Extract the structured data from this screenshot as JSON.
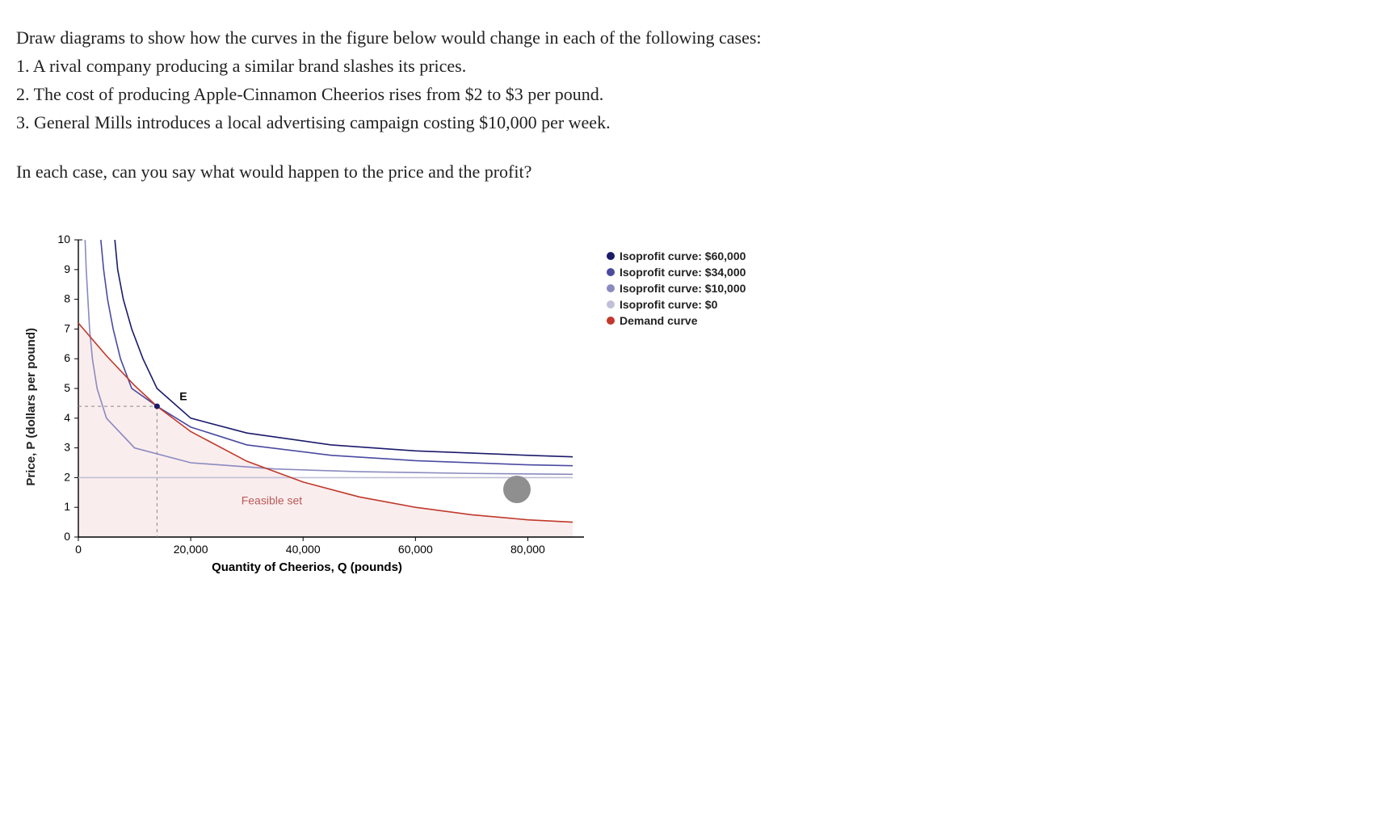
{
  "question": {
    "intro": "Draw diagrams to show how the curves in the figure below would change in each of the following cases:",
    "items": [
      "1. A rival company producing a similar brand slashes its prices.",
      "2. The cost of producing Apple-Cinnamon Cheerios rises from $2 to $3 per pound.",
      "3. General Mills introduces a local advertising campaign costing $10,000 per week."
    ],
    "followup": "In each case, can you say what would happen to the price and the profit?"
  },
  "chart_data": {
    "type": "line",
    "title": "",
    "xlabel": "Quantity of Cheerios, Q (pounds)",
    "ylabel": "Price, P (dollars per pound)",
    "xlim": [
      0,
      90000
    ],
    "ylim": [
      0,
      10
    ],
    "xticks": [
      0,
      20000,
      40000,
      60000,
      80000
    ],
    "xtick_labels": [
      "0",
      "20,000",
      "40,000",
      "60,000",
      "80,000"
    ],
    "yticks": [
      0,
      1,
      2,
      3,
      4,
      5,
      6,
      7,
      8,
      9,
      10
    ],
    "annotations": [
      {
        "label": "E",
        "x": 18000,
        "y": 4.6
      },
      {
        "label": "Feasible set",
        "x": 29000,
        "y": 1.1
      }
    ],
    "equilibrium_point": {
      "x": 14000,
      "y": 4.4
    },
    "feasible_region": true,
    "series": [
      {
        "name": "Isoprofit curve: $60,000",
        "color": "#1a1a6a",
        "type": "isoprofit",
        "values": [
          {
            "x": 6500,
            "y": 10
          },
          {
            "x": 7000,
            "y": 9
          },
          {
            "x": 8000,
            "y": 8
          },
          {
            "x": 9500,
            "y": 7
          },
          {
            "x": 11500,
            "y": 6
          },
          {
            "x": 14000,
            "y": 5
          },
          {
            "x": 20000,
            "y": 4
          },
          {
            "x": 30000,
            "y": 3.5
          },
          {
            "x": 45000,
            "y": 3.1
          },
          {
            "x": 60000,
            "y": 2.9
          },
          {
            "x": 80000,
            "y": 2.75
          },
          {
            "x": 88000,
            "y": 2.7
          }
        ]
      },
      {
        "name": "Isoprofit curve: $34,000",
        "color": "#4a4aa0",
        "type": "isoprofit",
        "values": [
          {
            "x": 4000,
            "y": 10
          },
          {
            "x": 4500,
            "y": 9
          },
          {
            "x": 5200,
            "y": 8
          },
          {
            "x": 6200,
            "y": 7
          },
          {
            "x": 7500,
            "y": 6
          },
          {
            "x": 9500,
            "y": 5
          },
          {
            "x": 14000,
            "y": 4.4
          },
          {
            "x": 20000,
            "y": 3.7
          },
          {
            "x": 30000,
            "y": 3.1
          },
          {
            "x": 45000,
            "y": 2.75
          },
          {
            "x": 60000,
            "y": 2.57
          },
          {
            "x": 80000,
            "y": 2.43
          },
          {
            "x": 88000,
            "y": 2.4
          }
        ]
      },
      {
        "name": "Isoprofit curve: $10,000",
        "color": "#8a8ac0",
        "type": "isoprofit",
        "values": [
          {
            "x": 1200,
            "y": 10
          },
          {
            "x": 1400,
            "y": 9
          },
          {
            "x": 1700,
            "y": 8
          },
          {
            "x": 2000,
            "y": 7
          },
          {
            "x": 2500,
            "y": 6
          },
          {
            "x": 3333,
            "y": 5
          },
          {
            "x": 5000,
            "y": 4
          },
          {
            "x": 10000,
            "y": 3
          },
          {
            "x": 20000,
            "y": 2.5
          },
          {
            "x": 35000,
            "y": 2.29
          },
          {
            "x": 50000,
            "y": 2.2
          },
          {
            "x": 70000,
            "y": 2.14
          },
          {
            "x": 88000,
            "y": 2.11
          }
        ]
      },
      {
        "name": "Isoprofit curve: $0",
        "color": "#c0c0d8",
        "type": "isoprofit",
        "values": [
          {
            "x": 0,
            "y": 2
          },
          {
            "x": 88000,
            "y": 2
          }
        ]
      },
      {
        "name": "Demand curve",
        "color": "#c0392b",
        "type": "demand",
        "values": [
          {
            "x": 0,
            "y": 7.2
          },
          {
            "x": 5000,
            "y": 6.1
          },
          {
            "x": 10000,
            "y": 5.1
          },
          {
            "x": 14000,
            "y": 4.4
          },
          {
            "x": 20000,
            "y": 3.55
          },
          {
            "x": 30000,
            "y": 2.55
          },
          {
            "x": 40000,
            "y": 1.85
          },
          {
            "x": 50000,
            "y": 1.35
          },
          {
            "x": 60000,
            "y": 1.0
          },
          {
            "x": 70000,
            "y": 0.75
          },
          {
            "x": 80000,
            "y": 0.58
          },
          {
            "x": 88000,
            "y": 0.5
          }
        ]
      }
    ],
    "legend_position": "right"
  }
}
